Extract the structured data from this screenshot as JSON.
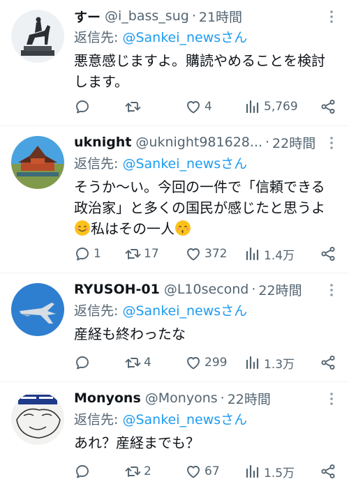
{
  "tweets": [
    {
      "name": "すー",
      "handle": "@i_bass_sug",
      "time": "21時間",
      "reply_prefix": "返信先: ",
      "reply_to": "@Sankei_newsさん",
      "lines": [
        "悪意感じますよ。購読やめることを検討",
        "します。"
      ],
      "stats": {
        "replies": "",
        "retweets": "",
        "likes": "4",
        "views": "5,769"
      }
    },
    {
      "name": "uknight",
      "handle": "@uknight981628...",
      "time": "22時間",
      "reply_prefix": "返信先: ",
      "reply_to": "@Sankei_newsさん",
      "lines": [
        "そうか〜い。今回の一件で「信頼できる",
        "政治家」と多くの国民が感じたと思うよ"
      ],
      "line3_text": "私はその一人",
      "stats": {
        "replies": "1",
        "retweets": "17",
        "likes": "372",
        "views": "1.4万"
      }
    },
    {
      "name": "RYUSOH-01",
      "handle": "@L10second",
      "time": "22時間",
      "reply_prefix": "返信先: ",
      "reply_to": "@Sankei_newsさん",
      "lines": [
        "産経も終わったな"
      ],
      "stats": {
        "replies": "",
        "retweets": "4",
        "likes": "299",
        "views": "1.3万"
      }
    },
    {
      "name": "Monyons",
      "handle": "@Monyons",
      "time": "22時間",
      "reply_prefix": "返信先: ",
      "reply_to": "@Sankei_newsさん",
      "lines": [
        "あれ？産経までも？"
      ],
      "stats": {
        "replies": "",
        "retweets": "2",
        "likes": "67",
        "views": "1.5万"
      }
    }
  ],
  "colors": {
    "text": "#0f1419",
    "secondary": "#536471",
    "link": "#1d9bf0",
    "divider": "#eff3f4"
  },
  "icons": {
    "reply": "reply-icon",
    "retweet": "retweet-icon",
    "like": "heart-icon",
    "views": "views-icon",
    "share": "share-icon",
    "more": "more-icon"
  }
}
